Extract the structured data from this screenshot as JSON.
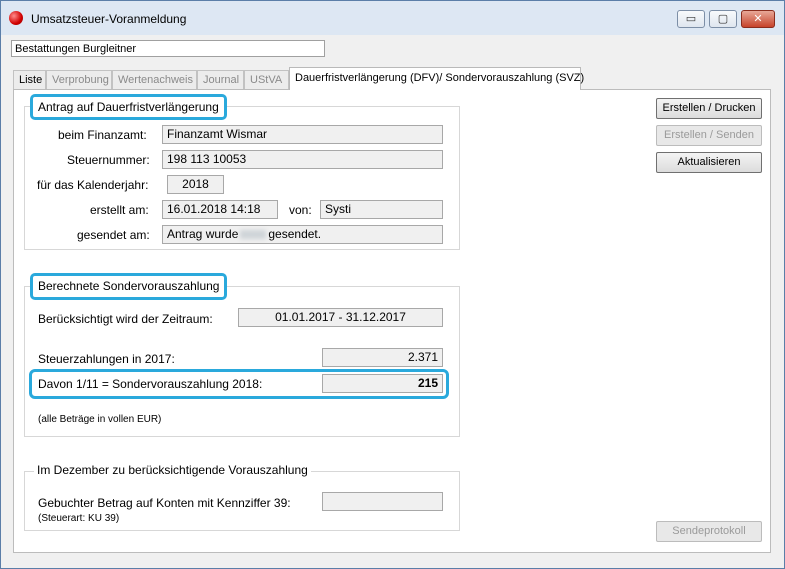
{
  "window": {
    "title": "Umsatzsteuer-Voranmeldung",
    "minimize_glyph": "▭",
    "maximize_glyph": "▢",
    "close_glyph": "✕"
  },
  "company": {
    "value": "Bestattungen Burgleitner"
  },
  "tabs": [
    {
      "label": "Liste",
      "enabled": true
    },
    {
      "label": "Verprobung",
      "enabled": false
    },
    {
      "label": "Wertenachweis",
      "enabled": false
    },
    {
      "label": "Journal",
      "enabled": false
    },
    {
      "label": "UStVA",
      "enabled": false
    },
    {
      "label": "Dauerfristverlängerung (DFV)/ Sondervorauszahlung (SVZ)",
      "enabled": true,
      "active": true
    }
  ],
  "dfv": {
    "title": "Antrag auf Dauerfristverlängerung",
    "finanzamt_label": "beim Finanzamt:",
    "finanzamt_value": "Finanzamt Wismar",
    "steuernummer_label": "Steuernummer:",
    "steuernummer_value": "198 113 10053",
    "jahr_label": "für das Kalenderjahr:",
    "jahr_value": "2018",
    "erstellt_label": "erstellt am:",
    "erstellt_value": "16.01.2018 14:18",
    "von_label": "von:",
    "von_value": "Systi",
    "gesendet_label": "gesendet am:",
    "gesendet_prefix": "Antrag wurde",
    "gesendet_suffix": "gesendet."
  },
  "svz": {
    "title": "Berechnete Sondervorauszahlung",
    "zeitraum_label": "Berücksichtigt wird der Zeitraum:",
    "zeitraum_value": "01.01.2017 - 31.12.2017",
    "steuerzahlungen_label": "Steuerzahlungen in 2017:",
    "steuerzahlungen_value": "2.371",
    "davon_label": "Davon 1/11 = Sondervorauszahlung 2018:",
    "davon_value": "215",
    "hint": "(alle Beträge in vollen EUR)"
  },
  "dezember": {
    "title": "Im Dezember zu berücksichtigende Vorauszahlung",
    "gebucht_label": "Gebuchter Betrag auf Konten mit Kennziffer 39:",
    "gebucht_value": "",
    "steuerart": "(Steuerart: KU 39)"
  },
  "buttons": {
    "erstellen_drucken": "Erstellen / Drucken",
    "erstellen_senden": "Erstellen / Senden",
    "aktualisieren": "Aktualisieren",
    "sendeprotokoll": "Sendeprotokoll"
  },
  "colors": {
    "highlight": "#2aa9dc",
    "titlebar": "#dde7f3"
  }
}
